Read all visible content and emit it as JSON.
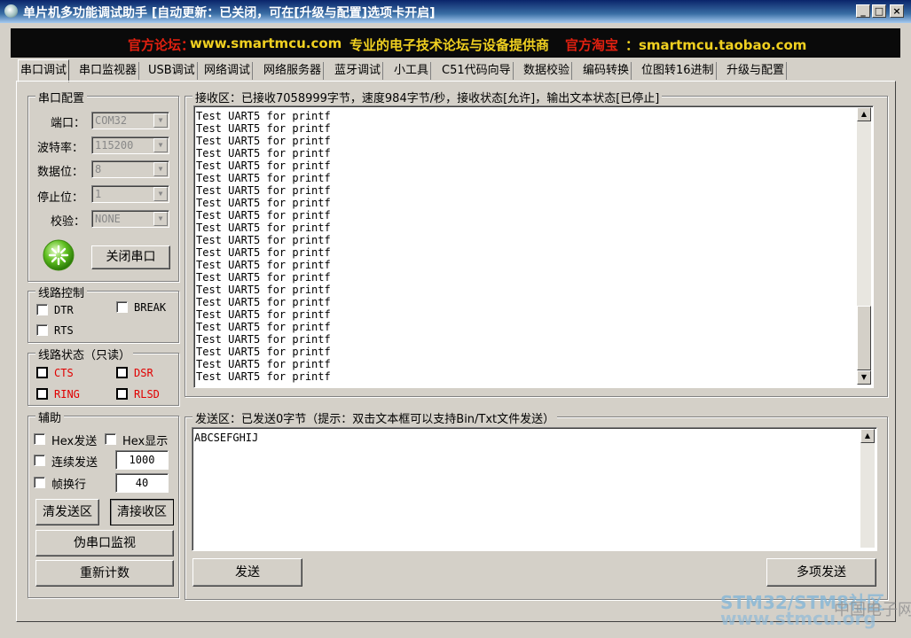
{
  "window": {
    "title": "单片机多功能调试助手 [自动更新：已关闭，可在[升级与配置]选项卡开启]",
    "minimize": "_",
    "maximize": "□",
    "close": "×"
  },
  "banner": {
    "forum_label": "官方论坛：",
    "forum_url": "www.smartmcu.com",
    "slogan": "专业的电子技术论坛与设备提供商",
    "shop_label": "官方淘宝",
    "shop_url": "：smartmcu.taobao.com"
  },
  "tabs": [
    "串口调试",
    "串口监视器",
    "USB调试",
    "网络调试",
    "网络服务器",
    "蓝牙调试",
    "小工具",
    "C51代码向导",
    "数据校验",
    "编码转换",
    "位图转16进制",
    "升级与配置"
  ],
  "serial_config": {
    "title": "串口配置",
    "port_label": "端口：",
    "port_value": "COM32",
    "baud_label": "波特率：",
    "baud_value": "115200",
    "databits_label": "数据位：",
    "databits_value": "8",
    "stopbits_label": "停止位：",
    "stopbits_value": "1",
    "parity_label": "校验：",
    "parity_value": "NONE",
    "close_port_button": "关闭串口"
  },
  "line_control": {
    "title": "线路控制",
    "dtr": "DTR",
    "break": "BREAK",
    "rts": "RTS"
  },
  "line_status": {
    "title": "线路状态（只读）",
    "cts": "CTS",
    "dsr": "DSR",
    "ring": "RING",
    "rlsd": "RLSD"
  },
  "aux": {
    "title": "辅助",
    "hex_send": "Hex发送",
    "hex_display": "Hex显示",
    "continuous_send": "连续发送",
    "continuous_interval": "1000",
    "frame_newline": "帧换行",
    "frame_value": "40",
    "clear_send_button": "清发送区",
    "clear_receive_button": "清接收区",
    "pseudo_monitor_button": "伪串口监视",
    "reset_count_button": "重新计数"
  },
  "receive": {
    "title": "接收区：已接收7058999字节，速度984字节/秒，接收状态[允许]，输出文本状态[已停止]",
    "lines": [
      "Test UART5 for printf",
      "Test UART5 for printf",
      "Test UART5 for printf",
      "Test UART5 for printf",
      "Test UART5 for printf",
      "Test UART5 for printf",
      "Test UART5 for printf",
      "Test UART5 for printf",
      "Test UART5 for printf",
      "Test UART5 for printf",
      "Test UART5 for printf",
      "Test UART5 for printf",
      "Test UART5 for printf",
      "Test UART5 for printf",
      "Test UART5 for printf",
      "Test UART5 for printf",
      "Test UART5 for printf",
      "Test UART5 for printf",
      "Test UART5 for printf",
      "Test UART5 for printf",
      "Test UART5 for printf",
      "Test UART5 for printf"
    ]
  },
  "send": {
    "title": "发送区：已发送0字节（提示：双击文本框可以支持Bin/Txt文件发送）",
    "content": "ABCSEFGHIJ",
    "send_button": "发送",
    "multi_send_button": "多项发送"
  },
  "watermark": {
    "line1": "STM32/STM8社区",
    "line2": "www.stmcu.org",
    "line3": "中国电子网"
  },
  "colors": {
    "banner_red": "#e02010",
    "banner_yellow": "#f0d020",
    "status_red": "#e00000"
  }
}
